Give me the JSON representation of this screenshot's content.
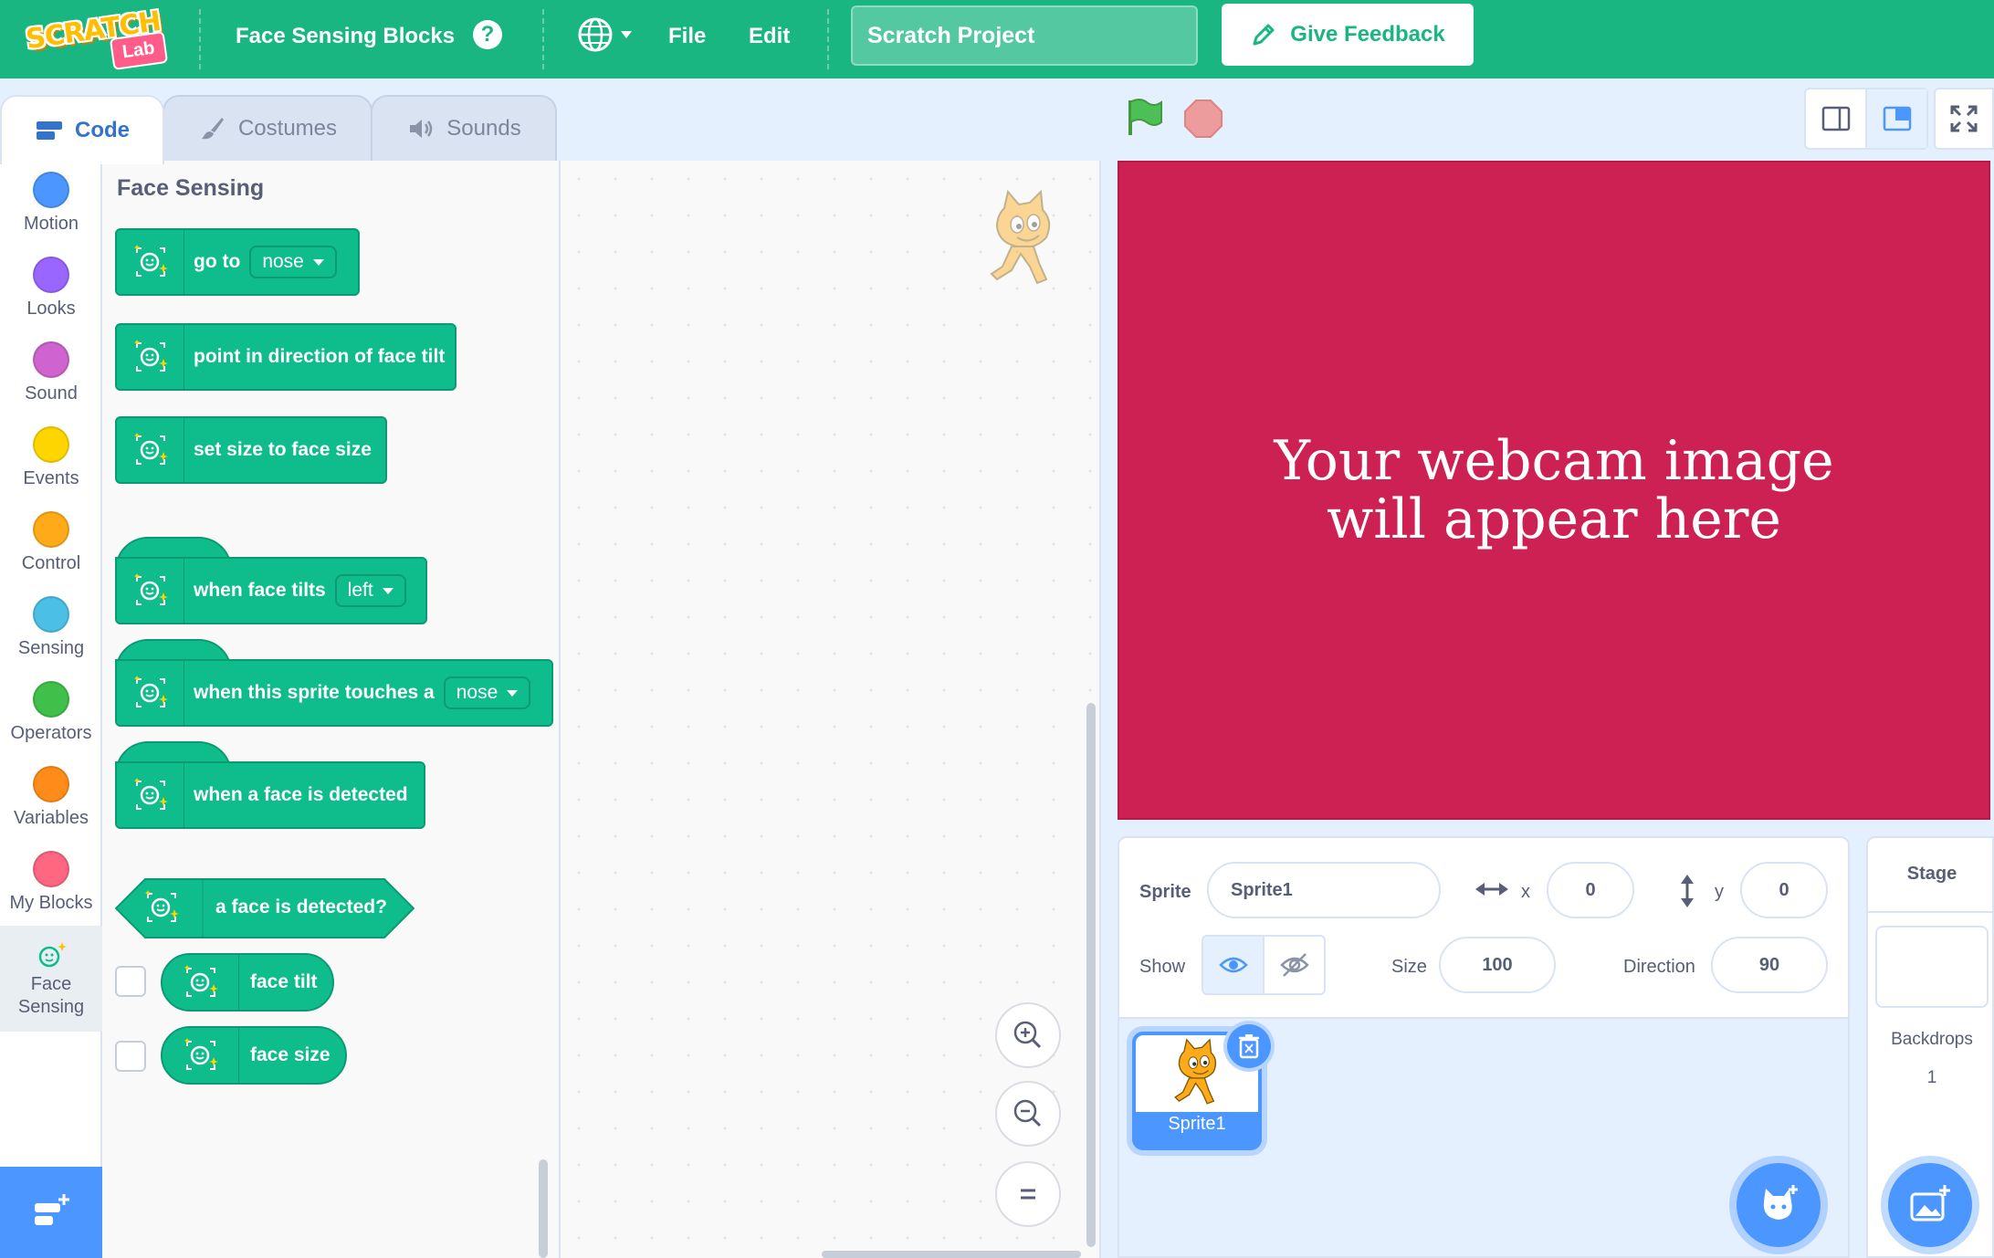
{
  "menubar": {
    "logo_text": "SCRATCH",
    "logo_badge": "Lab",
    "title": "Face Sensing Blocks",
    "help_icon": "?",
    "file_label": "File",
    "edit_label": "Edit",
    "project_title": "Scratch Project",
    "feedback_label": "Give Feedback"
  },
  "tabs": {
    "code": "Code",
    "costumes": "Costumes",
    "sounds": "Sounds"
  },
  "categories": [
    {
      "label": "Motion",
      "color": "#4c97ff"
    },
    {
      "label": "Looks",
      "color": "#9966ff"
    },
    {
      "label": "Sound",
      "color": "#cf63cf"
    },
    {
      "label": "Events",
      "color": "#ffd500"
    },
    {
      "label": "Control",
      "color": "#ffab19"
    },
    {
      "label": "Sensing",
      "color": "#4cbfe6"
    },
    {
      "label": "Operators",
      "color": "#40bf4a"
    },
    {
      "label": "Variables",
      "color": "#ff8c1a"
    },
    {
      "label": "My Blocks",
      "color": "#ff6680"
    },
    {
      "label": "Face Sensing",
      "color": "#0fbd8c"
    }
  ],
  "palette": {
    "title": "Face Sensing",
    "blocks": {
      "goto_text": "go to",
      "goto_option": "nose",
      "point_text": "point in direction of face tilt",
      "setsize_text": "set size to face size",
      "whentilts_text": "when face tilts",
      "whentilts_option": "left",
      "touches_text": "when this sprite touches a",
      "touches_option": "nose",
      "detected_text": "when a face is detected",
      "isdetected_text": "a face is detected?",
      "facetilt_text": "face tilt",
      "facesize_text": "face size"
    }
  },
  "stage": {
    "message": "Your webcam image will appear here",
    "color": "#cd2153"
  },
  "sprite_info": {
    "sprite_label": "Sprite",
    "sprite_name": "Sprite1",
    "x_label": "x",
    "x_value": "0",
    "y_label": "y",
    "y_value": "0",
    "show_label": "Show",
    "size_label": "Size",
    "size_value": "100",
    "direction_label": "Direction",
    "direction_value": "90"
  },
  "sprites": [
    {
      "name": "Sprite1",
      "selected": true
    }
  ],
  "target_pane": {
    "title": "Stage",
    "backdrops_label": "Backdrops",
    "backdrops_count": "1"
  },
  "colors": {
    "menubar": "#1ab682",
    "block": "#0fbd8c",
    "accent": "#4c97ff"
  }
}
